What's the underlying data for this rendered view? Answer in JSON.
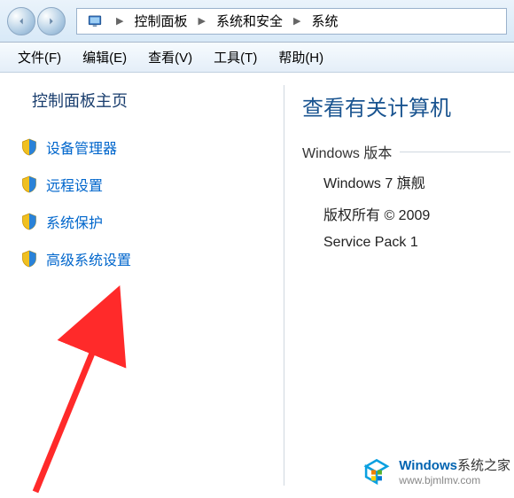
{
  "breadcrumb": {
    "items": [
      "控制面板",
      "系统和安全",
      "系统"
    ]
  },
  "menu": {
    "file": "文件(F)",
    "edit": "编辑(E)",
    "view": "查看(V)",
    "tools": "工具(T)",
    "help": "帮助(H)"
  },
  "sidebar": {
    "title": "控制面板主页",
    "links": {
      "device_manager": "设备管理器",
      "remote_settings": "远程设置",
      "system_protection": "系统保护",
      "advanced_settings": "高级系统设置"
    }
  },
  "main": {
    "title": "查看有关计算机",
    "section": "Windows 版本",
    "os_name": "Windows 7 旗舰",
    "copyright": "版权所有 © 2009",
    "service_pack": "Service Pack 1"
  },
  "watermark": {
    "brand": "Windows",
    "suffix": "系统之家",
    "url": "www.bjmlmv.com"
  }
}
